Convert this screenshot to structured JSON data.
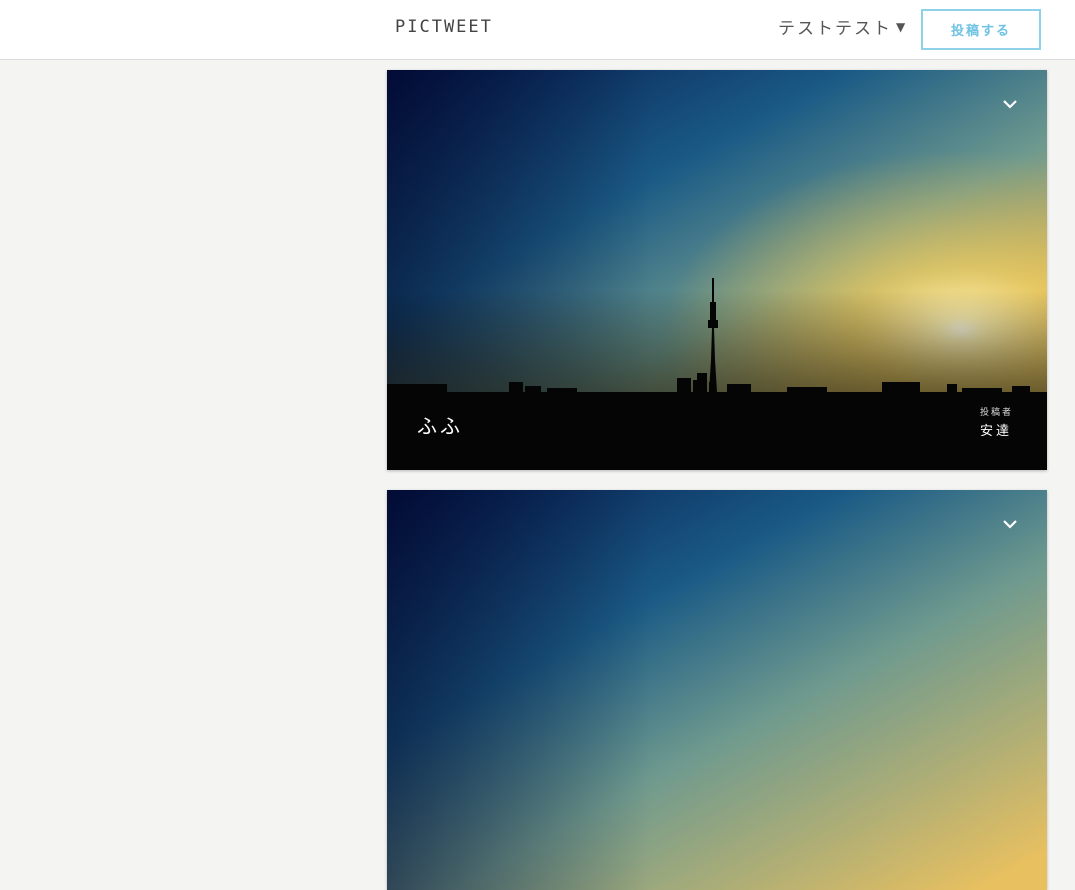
{
  "header": {
    "logo": "PICTWEET",
    "user_name": "テストテスト",
    "caret": "▼",
    "post_button": "投稿する"
  },
  "posts": [
    {
      "title": "ふふ",
      "poster_label": "投稿者",
      "poster_name": "安達",
      "menu_icon": "chevron-down-icon"
    },
    {
      "menu_icon": "chevron-down-icon"
    }
  ],
  "colors": {
    "accent": "#6ec3e3",
    "page_background": "#f4f4f2"
  }
}
